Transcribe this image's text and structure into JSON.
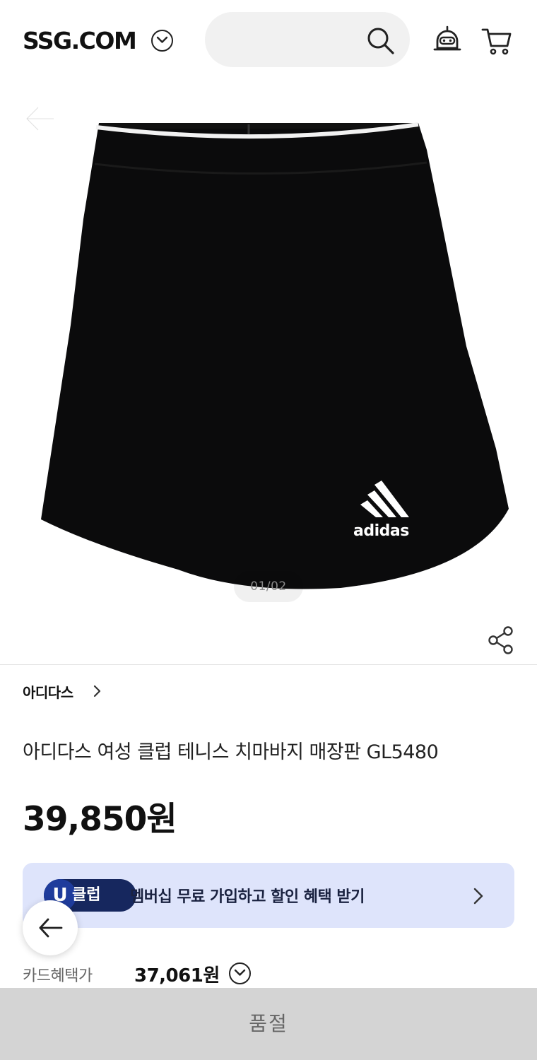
{
  "header": {
    "logo": "SSG.COM",
    "search_placeholder": "",
    "icons": [
      "chevron-down-icon",
      "search-icon",
      "bot-icon",
      "cart-icon"
    ]
  },
  "gallery": {
    "counter": "01/02",
    "image_brand_mark": "adidas"
  },
  "product": {
    "brand": "아디다스",
    "title": "아디다스 여성 클럽 테니스 치마바지 매장판 GL5480",
    "price": "39,850원"
  },
  "uclub": {
    "badge_u": "U",
    "badge_text": "클럽",
    "message": "멤버십 무료 가입하고 할인 혜택 받기"
  },
  "card_benefit": {
    "label": "카드혜택가",
    "price": "37,061원"
  },
  "footer": {
    "button_label": "품절"
  },
  "colors": {
    "uclub_bg": "#dee4fb",
    "uclub_badge": "#16275e",
    "soldout_bg": "#d4d4d4",
    "search_bg": "#f1f1f1"
  }
}
